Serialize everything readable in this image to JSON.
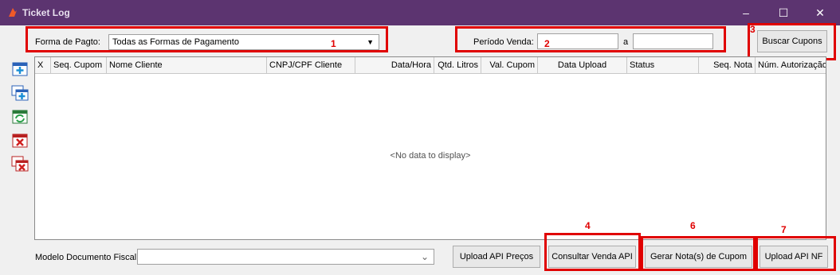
{
  "window": {
    "title": "Ticket Log",
    "controls": {
      "minimize": "–",
      "maximize": "☐",
      "close": "✕"
    }
  },
  "filters": {
    "payment_label": "Forma de Pagto:",
    "payment_value": "Todas as Formas de Pagamento",
    "period_label": "Período Venda:",
    "period_from": "",
    "period_separator": "a",
    "period_to": "",
    "search_button": "Buscar Cupons"
  },
  "markers": [
    "1",
    "2",
    "3",
    "4",
    "6",
    "7"
  ],
  "grid": {
    "columns": [
      "X",
      "Seq. Cupom",
      "Nome Cliente",
      "CNPJ/CPF Cliente",
      "Data/Hora",
      "Qtd. Litros",
      "Val. Cupom",
      "Data Upload",
      "Status",
      "Seq. Nota",
      "Núm. Autorização"
    ],
    "empty_text": "<No data to display>"
  },
  "footer": {
    "model_label": "Modelo Documento Fiscal:",
    "model_value": "",
    "btn_upload_precos": "Upload API Preços",
    "btn_consultar": "Consultar Venda API",
    "btn_gerar": "Gerar Nota(s) de Cupom",
    "btn_upload_nf": "Upload API NF"
  },
  "toolbar": [
    "add-icon",
    "add-multiple-icon",
    "refresh-icon",
    "delete-icon",
    "delete-multiple-icon"
  ],
  "colors": {
    "titlebar": "#5c3470",
    "highlight": "#e00000",
    "accent": "#1a6fc4"
  }
}
